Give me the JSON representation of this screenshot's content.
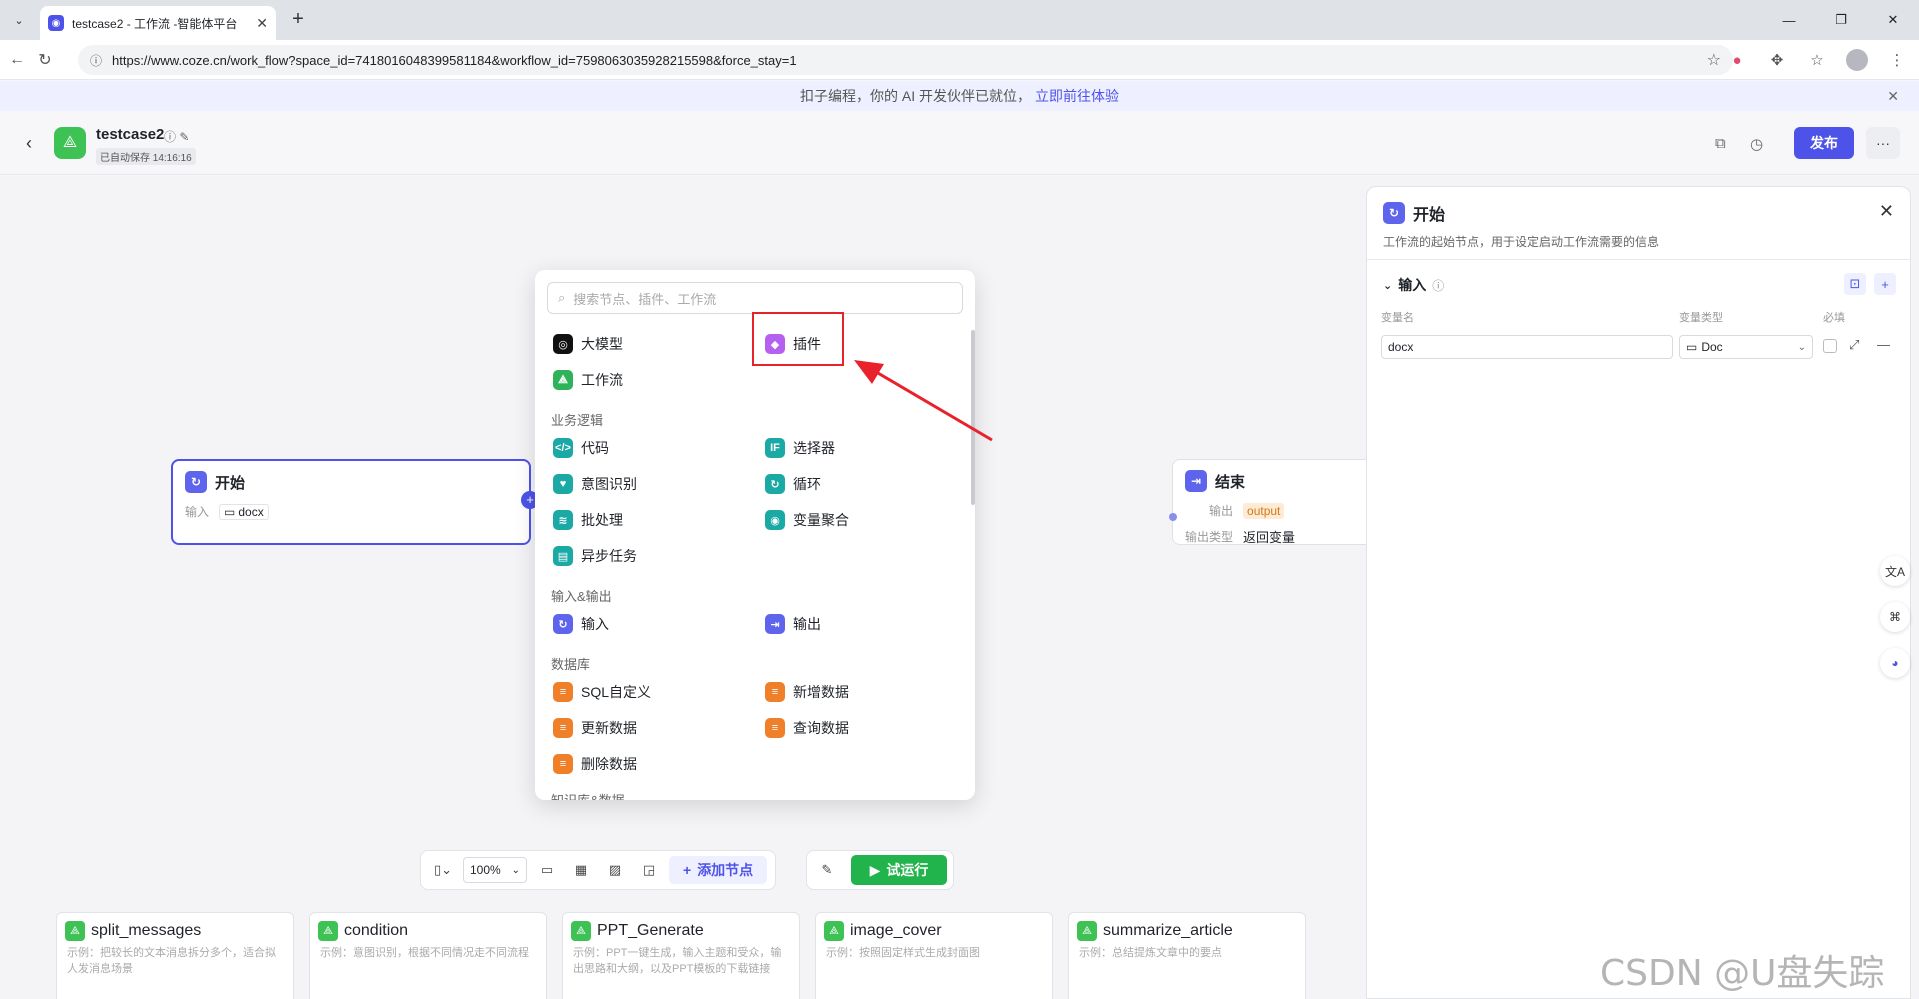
{
  "browser": {
    "tab_title": "testcase2 - 工作流 -智能体平台",
    "url": "https://www.coze.cn/work_flow?space_id=7418016048399581184&workflow_id=7598063035928215598&force_stay=1"
  },
  "notice": {
    "text": "扣子编程，你的 AI 开发伙伴已就位，",
    "link": "立即前往体验"
  },
  "header": {
    "app_name": "testcase2",
    "autosave": "已自动保存 14:16:16",
    "publish_label": "发布"
  },
  "nodes": {
    "start": {
      "title": "开始",
      "input_label": "输入",
      "input_value": "docx"
    },
    "end": {
      "title": "结束",
      "output_label": "输出",
      "output_value": "output",
      "output_type_label": "输出类型",
      "output_type_value": "返回变量"
    }
  },
  "popup": {
    "search_placeholder": "搜索节点、插件、工作流",
    "top_items": [
      "大模型",
      "插件",
      "工作流"
    ],
    "sections": [
      {
        "title": "业务逻辑",
        "items": [
          "代码",
          "选择器",
          "意图识别",
          "循环",
          "批处理",
          "变量聚合",
          "异步任务"
        ]
      },
      {
        "title": "输入&输出",
        "items": [
          "输入",
          "输出"
        ]
      },
      {
        "title": "数据库",
        "items": [
          "SQL自定义",
          "新增数据",
          "更新数据",
          "查询数据",
          "删除数据"
        ]
      },
      {
        "title": "知识库&数据"
      }
    ]
  },
  "panel": {
    "title": "开始",
    "description": "工作流的起始节点，用于设定启动工作流需要的信息",
    "section": "输入",
    "col_name": "变量名",
    "col_type": "变量类型",
    "col_required": "必填",
    "var_name": "docx",
    "var_type": "Doc"
  },
  "toolbar": {
    "zoom": "100%",
    "add_node": "添加节点",
    "trial_run": "试运行"
  },
  "templates": [
    {
      "name": "split_messages",
      "desc": "示例：把较长的文本消息拆分多个，适合拟人发消息场景"
    },
    {
      "name": "condition",
      "desc": "示例：意图识别，根据不同情况走不同流程"
    },
    {
      "name": "PPT_Generate",
      "desc": "示例：PPT一键生成，输入主题和受众，输出思路和大纲，以及PPT模板的下载链接"
    },
    {
      "name": "image_cover",
      "desc": "示例：按照固定样式生成封面图"
    },
    {
      "name": "summarize_article",
      "desc": "示例：总结提炼文章中的要点"
    }
  ],
  "watermark": "CSDN @U盘失踪了",
  "colors": {
    "accent": "#4d53e8",
    "trial_green": "#21b44c",
    "highlight_red": "#e8212a"
  }
}
